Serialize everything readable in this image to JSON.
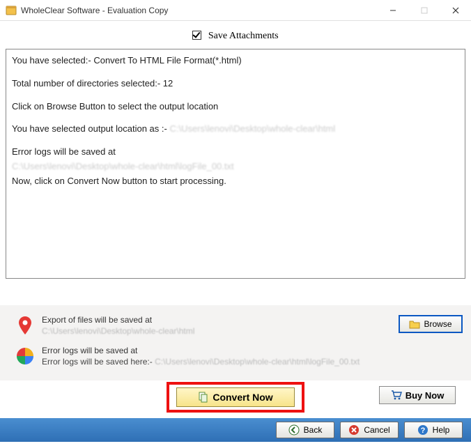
{
  "window": {
    "title": "WholeClear Software - Evaluation Copy"
  },
  "save_attachments_label": "Save Attachments",
  "log": {
    "line1": "You have selected:- Convert To HTML File Format(*.html)",
    "line2": "Total number of directories selected:- 12",
    "line3": "Click on Browse Button to select the output location",
    "line4_pre": "You have selected output location as :- ",
    "line4_path": "C:\\Users\\lenovi\\Desktop\\whole-clear\\html",
    "line5": "Error logs will be saved at",
    "line5_path": "C:\\Users\\lenovi\\Desktop\\whole-clear\\html\\logFile_00.txt",
    "line6": "Now, click on Convert Now button to start processing."
  },
  "export": {
    "head": "Export of files will be saved at",
    "path": "C:\\Users\\lenovi\\Desktop\\whole-clear\\html"
  },
  "errorlogs": {
    "head": "Error logs will be saved at",
    "sub_pre": "Error logs will be saved here:- ",
    "sub_path": "C:\\Users\\lenovi\\Desktop\\whole-clear\\html\\logFile_00.txt"
  },
  "buttons": {
    "browse": "Browse",
    "convert": "Convert Now",
    "buy": "Buy Now",
    "back": "Back",
    "cancel": "Cancel",
    "help": "Help"
  }
}
